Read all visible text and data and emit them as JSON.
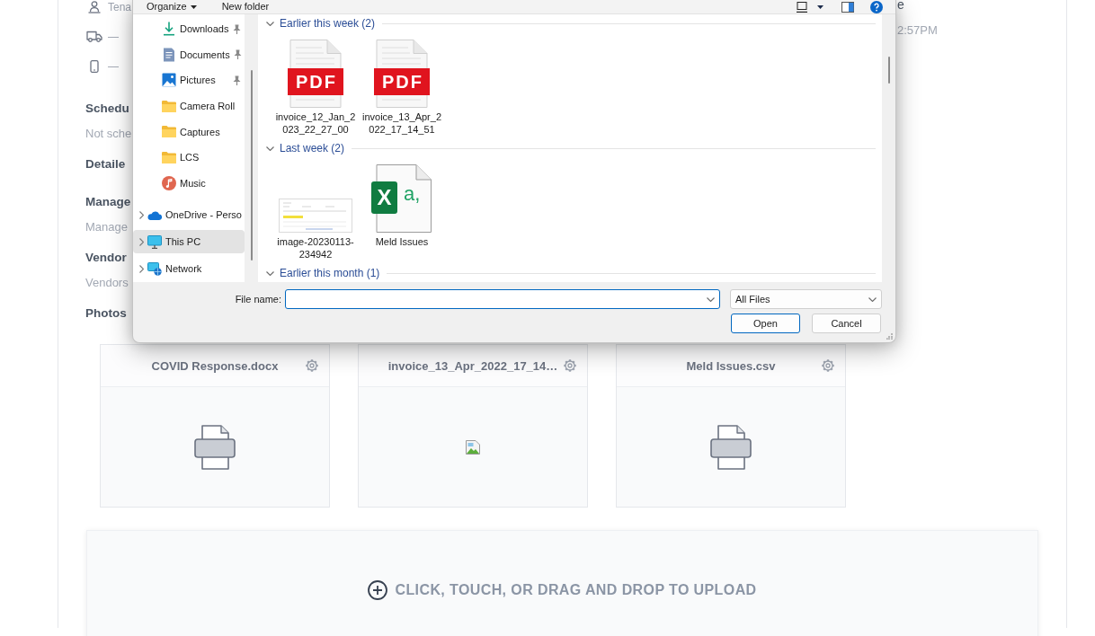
{
  "page": {
    "contacts": [
      {
        "kind": "user",
        "text": "Tena"
      },
      {
        "kind": "truck",
        "text": "—"
      },
      {
        "kind": "phone",
        "text": "—"
      }
    ],
    "header_fragment": "e",
    "timestamp": "2:57PM",
    "sections": [
      {
        "title": "Schedu",
        "value": "Not sche"
      },
      {
        "title": "Detaile"
      },
      {
        "title": "Manage",
        "value": "Manage"
      },
      {
        "title": "Vendor",
        "value": "Vendors"
      },
      {
        "title": "Photos"
      }
    ],
    "attachments": [
      {
        "name": "COVID Response.docx",
        "kind": "document"
      },
      {
        "name": "invoice_13_Apr_2022_17_14…",
        "kind": "broken_image"
      },
      {
        "name": "Meld Issues.csv",
        "kind": "document"
      }
    ],
    "upload_zone": {
      "label": "CLICK, TOUCH, OR DRAG AND DROP TO UPLOAD"
    }
  },
  "dialog": {
    "toolbar": {
      "organize": "Organize",
      "new_folder": "New folder"
    },
    "nav_items": [
      {
        "label": "Downloads",
        "kind": "quick",
        "pinned": true,
        "selected": false
      },
      {
        "label": "Documents",
        "kind": "quick",
        "pinned": true,
        "selected": false
      },
      {
        "label": "Pictures",
        "kind": "quick",
        "pinned": true,
        "selected": false
      },
      {
        "label": "Camera Roll",
        "kind": "quick",
        "pinned": false,
        "selected": false
      },
      {
        "label": "Captures",
        "kind": "quick",
        "pinned": false,
        "selected": false
      },
      {
        "label": "LCS",
        "kind": "quick",
        "pinned": false,
        "selected": false
      },
      {
        "label": "Music",
        "kind": "quick",
        "pinned": false,
        "selected": false
      },
      {
        "label": "OneDrive - Perso",
        "kind": "location",
        "pinned": false,
        "selected": false
      },
      {
        "label": "This PC",
        "kind": "location",
        "pinned": false,
        "selected": true
      },
      {
        "label": "Network",
        "kind": "location",
        "pinned": false,
        "selected": false
      }
    ],
    "groups": [
      {
        "title": "Earlier this week (2)",
        "expanded": true,
        "files": [
          {
            "name": "invoice_12_Jan_2023_22_27_00",
            "kind": "pdf",
            "badge": "PDF"
          },
          {
            "name": "invoice_13_Apr_2022_17_14_51",
            "kind": "pdf",
            "badge": "PDF"
          }
        ]
      },
      {
        "title": "Last week (2)",
        "expanded": true,
        "files": [
          {
            "name": "image-20230113-234942",
            "kind": "image"
          },
          {
            "name": "Meld Issues",
            "kind": "spreadsheet",
            "badge": "X",
            "badge_mark": "a,"
          }
        ]
      },
      {
        "title": "Earlier this month (1)",
        "expanded": true
      }
    ],
    "file_name": {
      "label": "File name:",
      "focused": true
    },
    "file_type": {
      "value": "All Files"
    },
    "buttons": [
      {
        "label": "Open",
        "default": true
      },
      {
        "label": "Cancel",
        "default": false
      }
    ]
  }
}
